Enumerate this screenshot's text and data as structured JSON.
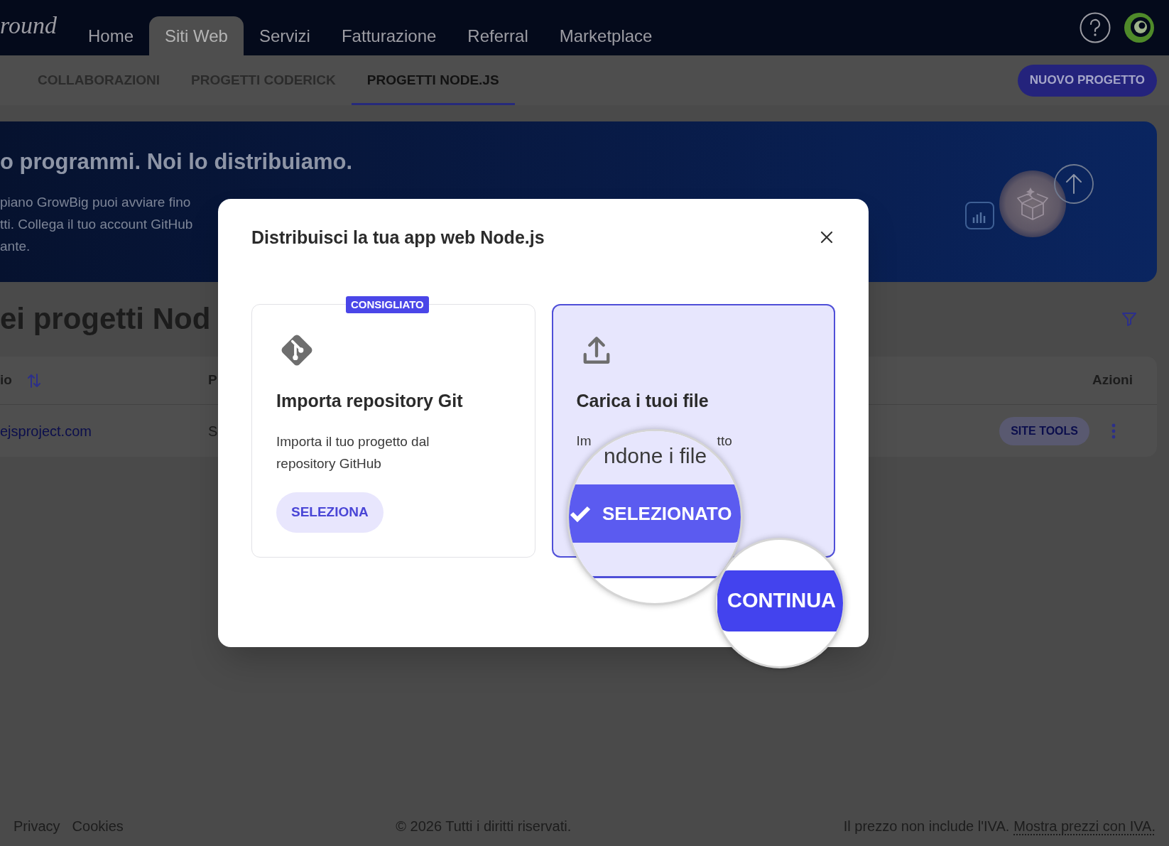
{
  "nav": {
    "logo": "round",
    "items": [
      {
        "label": "Home",
        "selected": false
      },
      {
        "label": "Siti Web",
        "selected": true
      },
      {
        "label": "Servizi",
        "selected": false
      },
      {
        "label": "Fatturazione",
        "selected": false
      },
      {
        "label": "Referral",
        "selected": false
      },
      {
        "label": "Marketplace",
        "selected": false
      }
    ]
  },
  "sub_nav": {
    "tabs": [
      {
        "label": "COLLABORAZIONI",
        "selected": false
      },
      {
        "label": "PROGETTI CODERICK",
        "selected": false
      },
      {
        "label": "PROGETTI NODE.JS",
        "selected": true
      }
    ],
    "button": "NUOVO PROGETTO"
  },
  "banner": {
    "heading": "o programmi. Noi lo distribuiamo.",
    "lines": [
      "piano GrowBig puoi avviare fino",
      "tti. Collega il tuo account GitHub",
      "ante."
    ]
  },
  "projects": {
    "heading": "ei progetti Nod",
    "columns": [
      "io",
      "P",
      "Azioni"
    ],
    "rows": [
      {
        "cells": [
          "ejsproject.com",
          "S"
        ],
        "button": "SITE TOOLS"
      }
    ]
  },
  "modal": {
    "title": "Distribuisci la tua app web Node.js",
    "options": [
      {
        "kind": "git",
        "badge": "CONSIGLIATO",
        "title": "Importa repository Git",
        "description_parts": [
          "Importa il tuo progetto dal repository GitHub"
        ],
        "button": "SELEZIONA",
        "selected": false
      },
      {
        "kind": "upload",
        "title": "Carica i tuoi file",
        "description_parts": [
          "Im",
          "tto"
        ],
        "selected": true
      }
    ]
  },
  "magnifiers": [
    {
      "kind": "option",
      "text": "ndone i file",
      "button": "SELEZIONATO"
    },
    {
      "kind": "action",
      "button": "CONTINUA"
    }
  ],
  "footer": {
    "links": [
      "Privacy",
      "Cookies"
    ],
    "copyright": "© 2026 Tutti i diritti riservati.",
    "price_note": "Il prezzo non include l'IVA.",
    "price_link": "Mostra prezzi con IVA."
  }
}
